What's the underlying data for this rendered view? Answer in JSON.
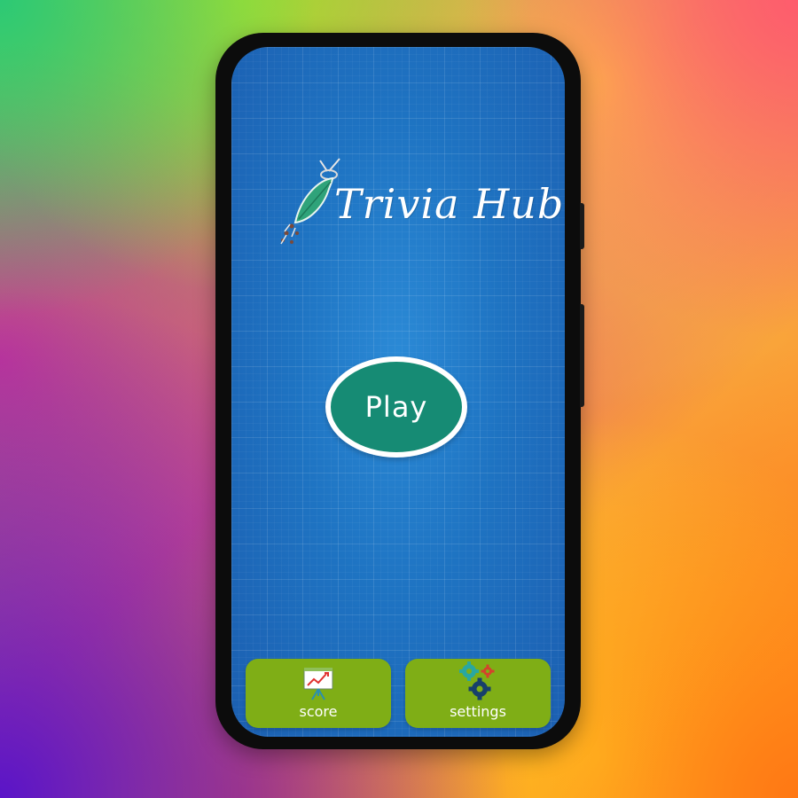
{
  "app": {
    "name": "Trivia Hub"
  },
  "main": {
    "play_label": "Play"
  },
  "bottom_nav": {
    "score_label": "score",
    "settings_label": "settings"
  },
  "colors": {
    "screen_blue": "#1e73c2",
    "play_green": "#168b74",
    "nav_green": "#7fae16",
    "logo_leaf": "#2fa37a"
  },
  "icons": {
    "logo": "leaf-mosquito-logo-icon",
    "score": "presentation-chart-icon",
    "settings": "gears-icon"
  }
}
